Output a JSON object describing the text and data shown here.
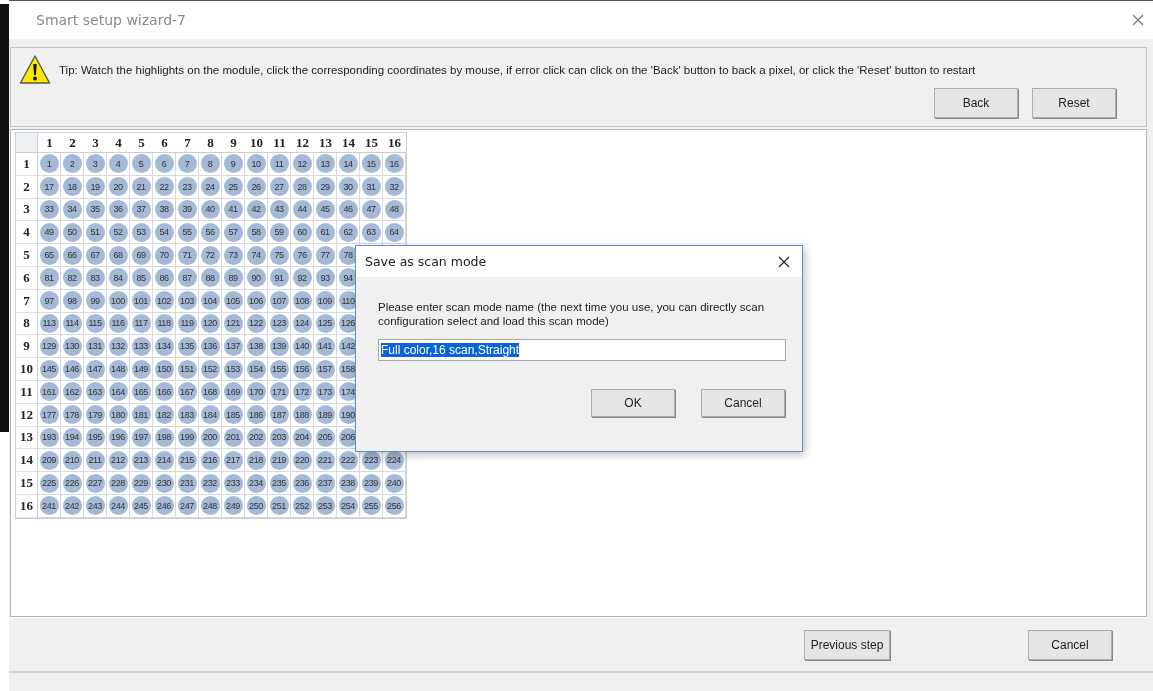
{
  "window": {
    "title": "Smart setup wizard-7"
  },
  "tip": {
    "text": "Tip: Watch the highlights on the module, click the corresponding coordinates by mouse, if error click  can click on the 'Back' button to back a pixel, or click the 'Reset' button to restart",
    "buttons": [
      "Back",
      "Reset"
    ]
  },
  "grid": {
    "columns": [
      "1",
      "2",
      "3",
      "4",
      "5",
      "6",
      "7",
      "8",
      "9",
      "10",
      "11",
      "12",
      "13",
      "14",
      "15",
      "16"
    ],
    "rows": [
      {
        "label": "1",
        "cells": [
          "1",
          "2",
          "3",
          "4",
          "5",
          "6",
          "7",
          "8",
          "9",
          "10",
          "11",
          "12",
          "13",
          "14",
          "15",
          "16"
        ]
      },
      {
        "label": "2",
        "cells": [
          "17",
          "18",
          "19",
          "20",
          "21",
          "22",
          "23",
          "24",
          "25",
          "26",
          "27",
          "28",
          "29",
          "30",
          "31",
          "32"
        ]
      },
      {
        "label": "3",
        "cells": [
          "33",
          "34",
          "35",
          "36",
          "37",
          "38",
          "39",
          "40",
          "41",
          "42",
          "43",
          "44",
          "45",
          "46",
          "47",
          "48"
        ]
      },
      {
        "label": "4",
        "cells": [
          "49",
          "50",
          "51",
          "52",
          "53",
          "54",
          "55",
          "56",
          "57",
          "58",
          "59",
          "60",
          "61",
          "62",
          "63",
          "64"
        ]
      },
      {
        "label": "5",
        "cells": [
          "65",
          "66",
          "67",
          "68",
          "69",
          "70",
          "71",
          "72",
          "73",
          "74",
          "75",
          "76",
          "77",
          "78"
        ]
      },
      {
        "label": "6",
        "cells": [
          "81",
          "82",
          "83",
          "84",
          "85",
          "86",
          "87",
          "88",
          "89",
          "90",
          "91",
          "92",
          "93",
          "94"
        ]
      },
      {
        "label": "7",
        "cells": [
          "97",
          "98",
          "99",
          "100",
          "101",
          "102",
          "103",
          "104",
          "105",
          "106",
          "107",
          "108",
          "109",
          "110"
        ]
      },
      {
        "label": "8",
        "cells": [
          "113",
          "114",
          "115",
          "116",
          "117",
          "118",
          "119",
          "120",
          "121",
          "122",
          "123",
          "124",
          "125",
          "126"
        ]
      },
      {
        "label": "9",
        "cells": [
          "129",
          "130",
          "131",
          "132",
          "133",
          "134",
          "135",
          "136",
          "137",
          "138",
          "139",
          "140",
          "141",
          "142"
        ]
      },
      {
        "label": "10",
        "cells": [
          "145",
          "146",
          "147",
          "148",
          "149",
          "150",
          "151",
          "152",
          "153",
          "154",
          "155",
          "156",
          "157",
          "158"
        ]
      },
      {
        "label": "11",
        "cells": [
          "161",
          "162",
          "163",
          "164",
          "165",
          "166",
          "167",
          "168",
          "169",
          "170",
          "171",
          "172",
          "173",
          "174"
        ]
      },
      {
        "label": "12",
        "cells": [
          "177",
          "178",
          "179",
          "180",
          "181",
          "182",
          "183",
          "184",
          "185",
          "186",
          "187",
          "188",
          "189",
          "190"
        ]
      },
      {
        "label": "13",
        "cells": [
          "193",
          "194",
          "195",
          "196",
          "197",
          "198",
          "199",
          "200",
          "201",
          "202",
          "203",
          "204",
          "205",
          "206"
        ]
      },
      {
        "label": "14",
        "cells": [
          "209",
          "210",
          "211",
          "212",
          "213",
          "214",
          "215",
          "216",
          "217",
          "218",
          "219",
          "220",
          "221",
          "222",
          "223",
          "224"
        ]
      },
      {
        "label": "15",
        "cells": [
          "225",
          "226",
          "227",
          "228",
          "229",
          "230",
          "231",
          "232",
          "233",
          "234",
          "235",
          "236",
          "237",
          "238",
          "239",
          "240"
        ]
      },
      {
        "label": "16",
        "cells": [
          "241",
          "242",
          "243",
          "244",
          "245",
          "246",
          "247",
          "248",
          "249",
          "250",
          "251",
          "252",
          "253",
          "254",
          "255",
          "256"
        ]
      }
    ]
  },
  "dialog": {
    "title": "Save as scan mode",
    "message": "Please enter scan mode name (the next time you use, you can directly scan configuration select and load this scan mode)",
    "value": "Full color,16 scan,Straight",
    "buttons": [
      "OK",
      "Cancel"
    ]
  },
  "footer_buttons": [
    "Previous step",
    "Cancel"
  ]
}
